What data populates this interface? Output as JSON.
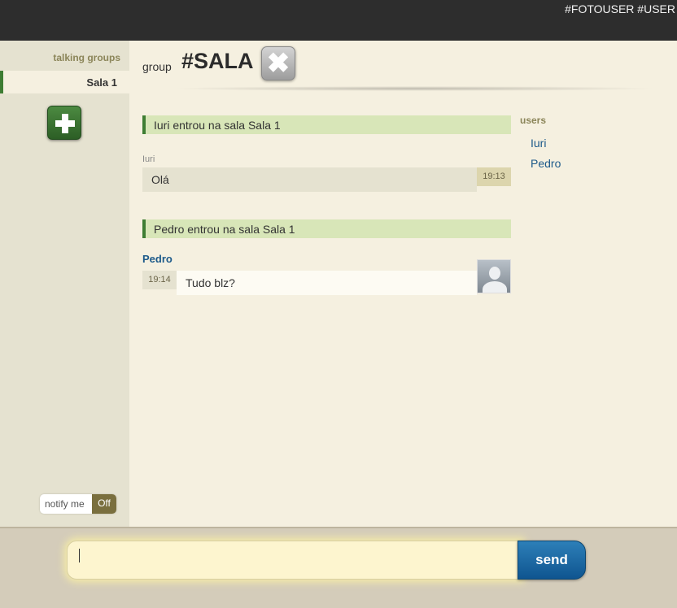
{
  "topbar": {
    "user_text": "#FOTOUSER #USER"
  },
  "sidebar": {
    "heading": "talking groups",
    "groups": [
      {
        "label": "Sala 1",
        "active": true
      }
    ],
    "add_icon": "plus-icon",
    "notify": {
      "label": "notify me",
      "state": "Off"
    }
  },
  "header": {
    "group_label": "group",
    "room_title": "#SALA",
    "close_glyph": "✖",
    "close_icon": "close-icon"
  },
  "chat": {
    "messages": [
      {
        "type": "notice",
        "text": "Iuri entrou na sala Sala 1"
      },
      {
        "type": "message",
        "author": "Iuri",
        "text": "Olá",
        "time": "19:13",
        "own": false
      },
      {
        "type": "notice",
        "text": "Pedro entrou na sala Sala 1"
      },
      {
        "type": "message",
        "author": "Pedro",
        "text": "Tudo blz?",
        "time": "19:14",
        "own": true,
        "avatar": "avatar-placeholder-icon"
      }
    ]
  },
  "users": {
    "heading": "users",
    "list": [
      "Iuri",
      "Pedro"
    ]
  },
  "composer": {
    "value": "",
    "send_label": "send"
  },
  "colors": {
    "topbar": "#2d2d2d",
    "sidebar": "#e5e2d0",
    "content": "#f5f0e0",
    "accent_green": "#3e7d33",
    "notice_bg": "#d8e6b8",
    "link_blue": "#1d5a8a",
    "send_blue": "#1a6aa3"
  }
}
